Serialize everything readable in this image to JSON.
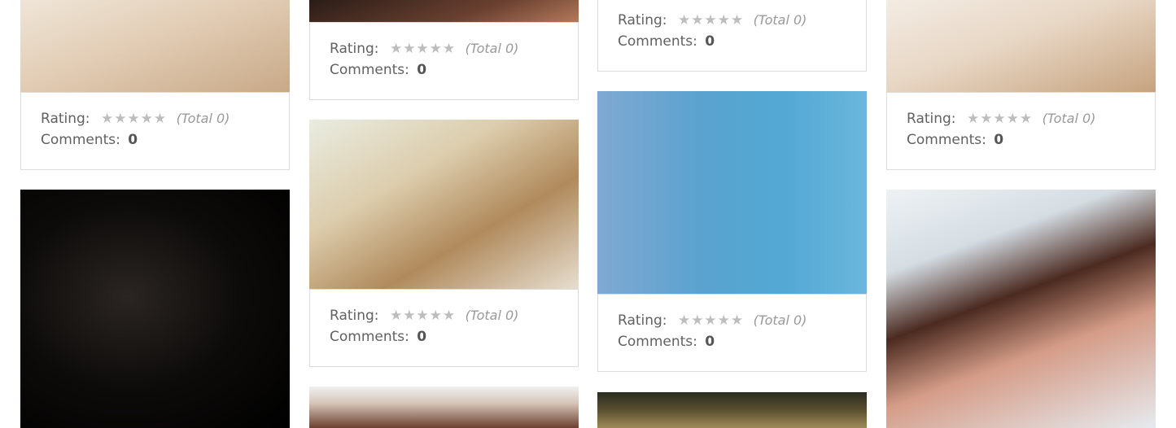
{
  "labels": {
    "rating": "Rating:",
    "total": "(Total 0)",
    "comments": "Comments:",
    "comments_value": "0",
    "stars": "★★★★★"
  },
  "cards": [
    {
      "id": "col1-top",
      "rating_label": "Rating:",
      "total": "(Total 0)",
      "comments_label": "Comments:",
      "comments_value": "0"
    },
    {
      "id": "col2-top",
      "rating_label": "Rating:",
      "total": "(Total 0)",
      "comments_label": "Comments:",
      "comments_value": "0"
    },
    {
      "id": "col3-top",
      "rating_label": "Rating:",
      "total": "(Total 0)",
      "comments_label": "Comments:",
      "comments_value": "0"
    },
    {
      "id": "col4-top",
      "rating_label": "Rating:",
      "total": "(Total 0)",
      "comments_label": "Comments:",
      "comments_value": "0"
    },
    {
      "id": "col2-mid",
      "rating_label": "Rating:",
      "total": "(Total 0)",
      "comments_label": "Comments:",
      "comments_value": "0"
    },
    {
      "id": "col3-mid",
      "rating_label": "Rating:",
      "total": "(Total 0)",
      "comments_label": "Comments:",
      "comments_value": "0"
    }
  ],
  "colors": {
    "border": "#dcdcdc",
    "text": "#616161",
    "star": "#bdbdbd"
  },
  "icons": [
    "star-icon"
  ]
}
